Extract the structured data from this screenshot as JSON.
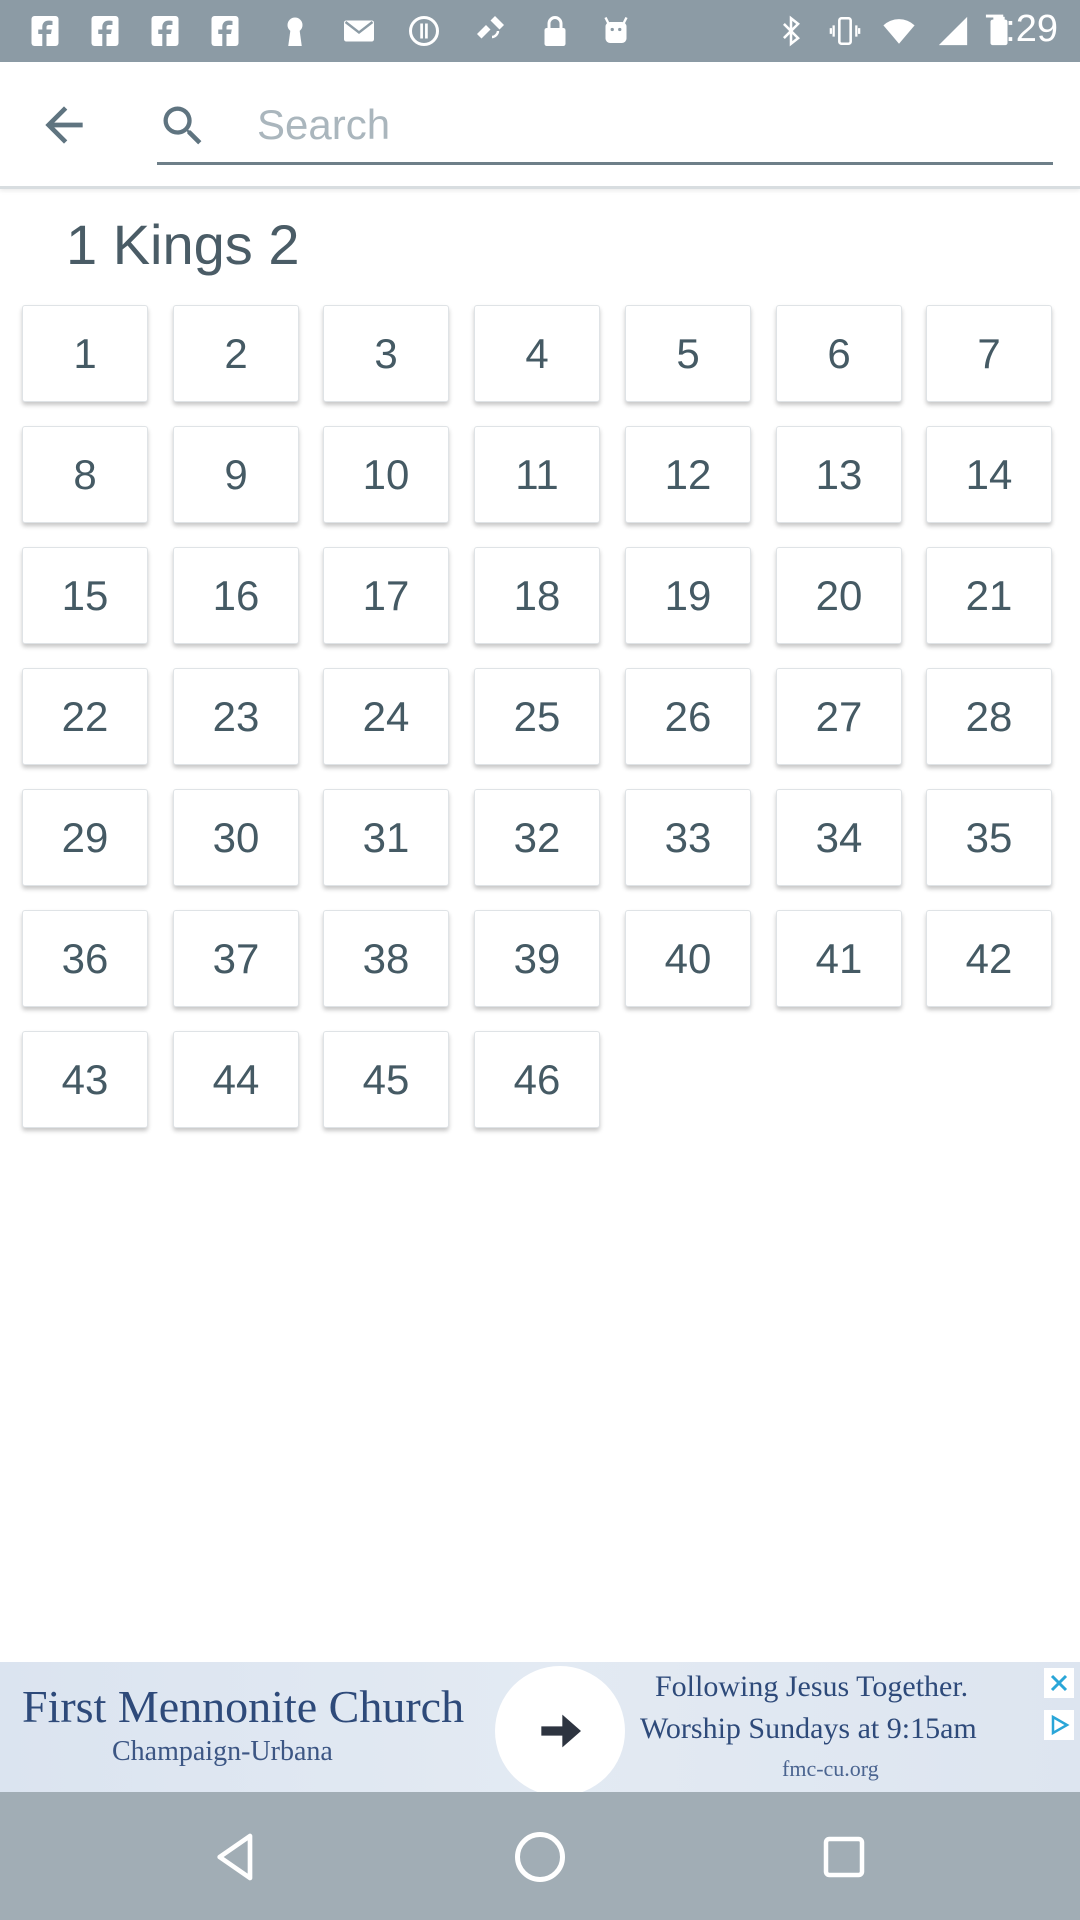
{
  "status_bar": {
    "time": "7:29",
    "left_icons": [
      "facebook-icon",
      "facebook-icon",
      "facebook-icon",
      "facebook-icon",
      "keyhole-icon",
      "mail-icon",
      "data-saver-icon",
      "satellite-icon",
      "lock-icon",
      "android-icon"
    ],
    "right_icons": [
      "bluetooth-icon",
      "vibrate-icon",
      "wifi-icon",
      "signal-icon",
      "battery-icon"
    ]
  },
  "header": {
    "back_icon": "arrow-back-icon",
    "search_icon": "search-icon",
    "search_placeholder": "Search"
  },
  "book": {
    "title": "1 Kings 2",
    "chapters": [
      "1",
      "2",
      "3",
      "4",
      "5",
      "6",
      "7",
      "8",
      "9",
      "10",
      "11",
      "12",
      "13",
      "14",
      "15",
      "16",
      "17",
      "18",
      "19",
      "20",
      "21",
      "22",
      "23",
      "24",
      "25",
      "26",
      "27",
      "28",
      "29",
      "30",
      "31",
      "32",
      "33",
      "34",
      "35",
      "36",
      "37",
      "38",
      "39",
      "40",
      "41",
      "42",
      "43",
      "44",
      "45",
      "46"
    ]
  },
  "ad": {
    "title": "First Mennonite Church",
    "subtitle": "Champaign-Urbana",
    "line1": "Following Jesus Together.",
    "line2": "Worship Sundays at 9:15am",
    "url": "fmc-cu.org"
  },
  "colors": {
    "status_bar": "#8c9ba5",
    "nav_bar": "#a1adb5",
    "text": "#455a64",
    "ad_text": "#2e4a7a"
  }
}
